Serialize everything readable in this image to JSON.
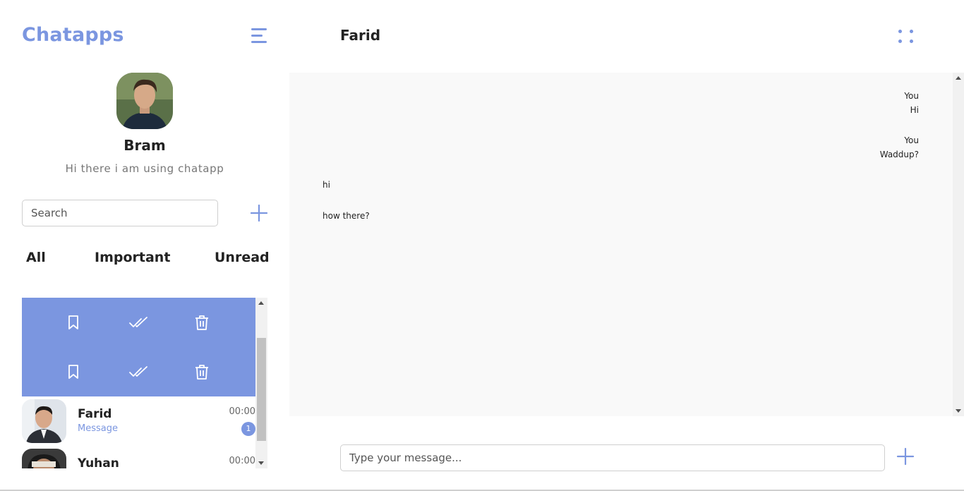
{
  "sidebar": {
    "brand": "Chatapps",
    "profile": {
      "name": "Bram",
      "status": "Hi there i am using chatapp"
    },
    "search": {
      "placeholder": "Search",
      "value": ""
    },
    "tabs": [
      {
        "label": "All"
      },
      {
        "label": "Important"
      },
      {
        "label": "Unread"
      }
    ],
    "chats": [
      {
        "name": "Farid",
        "preview": "Message",
        "time": "00:00",
        "unread": "1"
      },
      {
        "name": "Yuhan",
        "preview": "",
        "time": "00:00",
        "unread": ""
      }
    ]
  },
  "chat": {
    "contact_name": "Farid",
    "messages": [
      {
        "direction": "out",
        "sender": "You",
        "text": "Hi"
      },
      {
        "direction": "out",
        "sender": "You",
        "text": "Waddup?"
      },
      {
        "direction": "in",
        "sender": "",
        "text": "hi"
      },
      {
        "direction": "in",
        "sender": "",
        "text": "how there?"
      }
    ],
    "input": {
      "placeholder": "Type your message...",
      "value": ""
    }
  },
  "icons": {
    "menu": "hamburger-menu-icon",
    "add": "plus-icon",
    "bookmark": "bookmark-icon",
    "read": "double-check-icon",
    "delete": "trash-icon",
    "more": "four-dots-icon"
  },
  "colors": {
    "accent": "#7b96e0",
    "message_area": "#f9f9f9",
    "text": "#222222",
    "muted": "#777777"
  }
}
